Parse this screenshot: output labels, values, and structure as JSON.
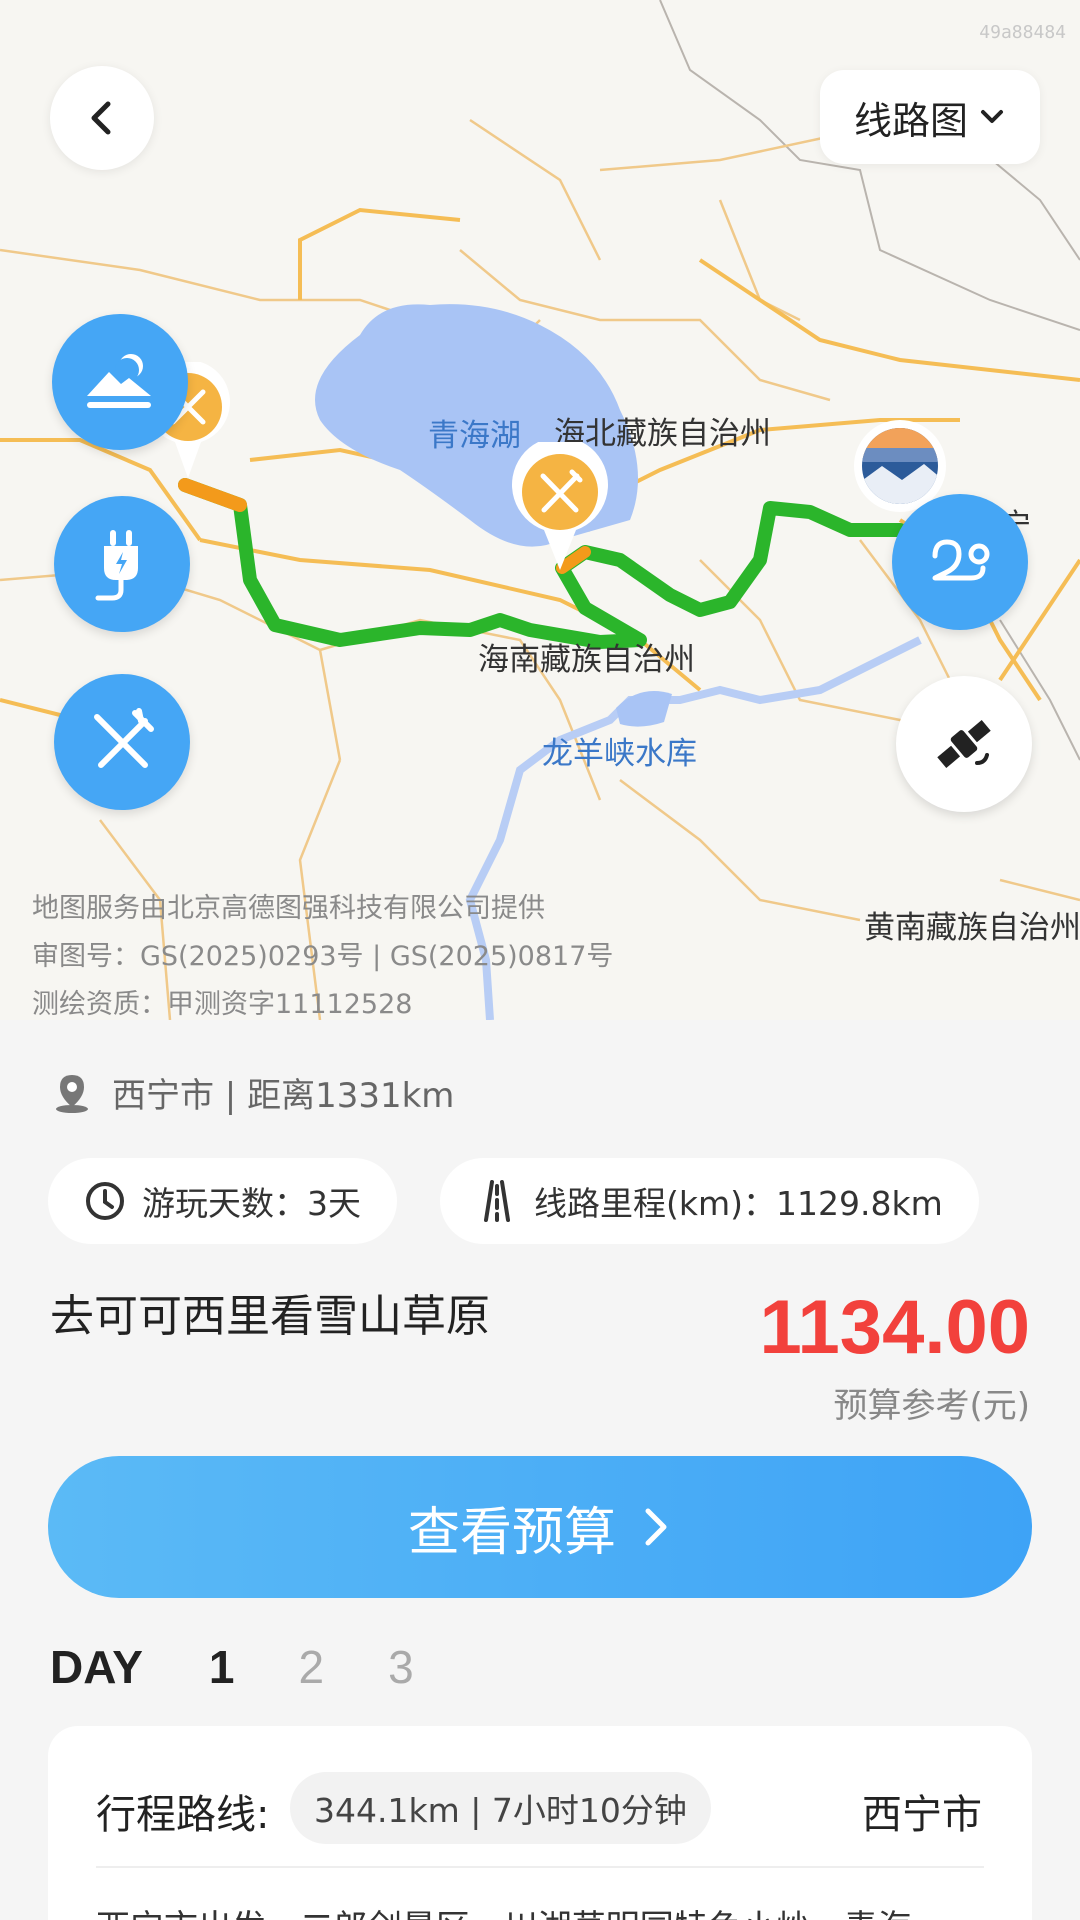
{
  "watermark": "49a88484",
  "header": {
    "back_icon": "chevron-left-icon",
    "map_type_label": "线路图",
    "map_type_icon": "chevron-down-icon"
  },
  "map": {
    "labels": {
      "qinghai_lake": "青海湖",
      "haibei": "海北藏族自治州",
      "hainan": "海南藏族自治州",
      "longyangxia": "龙羊峡水库",
      "huangnan": "黄南藏族自治州",
      "xining_partial": "宁"
    },
    "left_buttons": [
      {
        "name": "scenery-icon"
      },
      {
        "name": "charging-icon"
      },
      {
        "name": "dining-icon"
      }
    ],
    "right_buttons": [
      {
        "name": "route-icon"
      },
      {
        "name": "satellite-icon"
      }
    ],
    "copyright": {
      "line1": "地图服务由北京高德图强科技有限公司提供",
      "line2": "审图号：GS(2025)0293号 | GS(2025)0817号",
      "line3": "测绘资质：甲测资字11112528"
    },
    "colors": {
      "route": "#2bb52b",
      "route_segment": "#f39a1b",
      "pin": "#f5b443",
      "lake": "#a9c4f5",
      "road": "#f5c56a"
    }
  },
  "trip": {
    "location": "西宁市 | 距离1331km",
    "days_label": "游玩天数：3天",
    "distance_label": "线路里程(km)：1129.8km",
    "title": "去可可西里看雪山草原",
    "price": "1134.00",
    "price_label": "预算参考(元)",
    "cta_label": "查看预算",
    "accent": "#45a6f5",
    "price_color": "#f2413c"
  },
  "days": {
    "label": "DAY",
    "tabs": [
      "1",
      "2",
      "3"
    ],
    "active": "1"
  },
  "route_card": {
    "label": "行程路线:",
    "summary": "344.1km | 7小时10分钟",
    "end": "西宁市",
    "itinerary": "西宁市出发 - 二郎剑景区 - 川湖草明园特色小炒 - 青海"
  }
}
